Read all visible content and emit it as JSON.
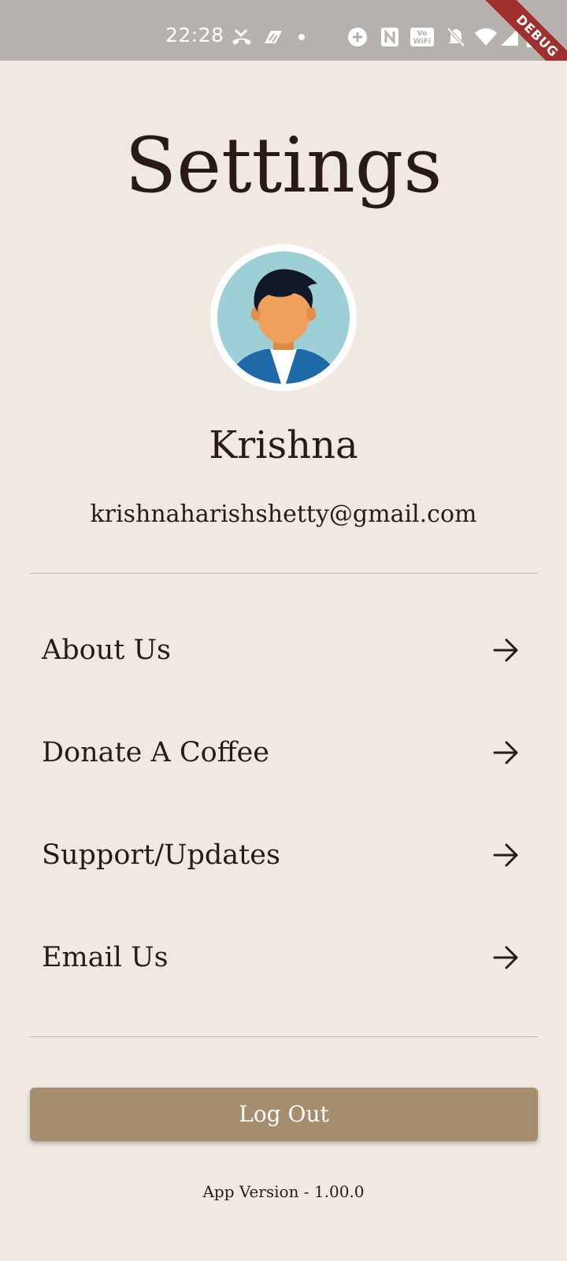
{
  "status_bar": {
    "time": "22:28",
    "debug_label": "DEBUG",
    "icons": [
      "missed-call-icon",
      "app-notification-icon",
      "dot-icon",
      "data-saver-icon",
      "nfc-icon",
      "vowifi-icon",
      "silent-icon",
      "wifi-icon",
      "signal-icon",
      "battery-icon"
    ]
  },
  "header": {
    "title": "Settings"
  },
  "profile": {
    "avatar_icon": "user-avatar-icon",
    "name": "Krishna",
    "email": "krishnaharishshetty@gmail.com"
  },
  "menu": {
    "items": [
      {
        "label": "About Us",
        "icon": "arrow-right-icon"
      },
      {
        "label": "Donate A Coffee",
        "icon": "arrow-right-icon"
      },
      {
        "label": "Support/Updates",
        "icon": "arrow-right-icon"
      },
      {
        "label": "Email Us",
        "icon": "arrow-right-icon"
      }
    ]
  },
  "actions": {
    "logout_label": "Log Out"
  },
  "footer": {
    "app_version": "App Version - 1.00.0"
  },
  "colors": {
    "background": "#f0e9e2",
    "status_bar": "#b5b1ac",
    "text": "#2a1a16",
    "divider": "#c8bda8",
    "logout_button": "#a58d6e",
    "avatar_bg": "#9dd0d6",
    "debug_ribbon": "#a0302f"
  }
}
